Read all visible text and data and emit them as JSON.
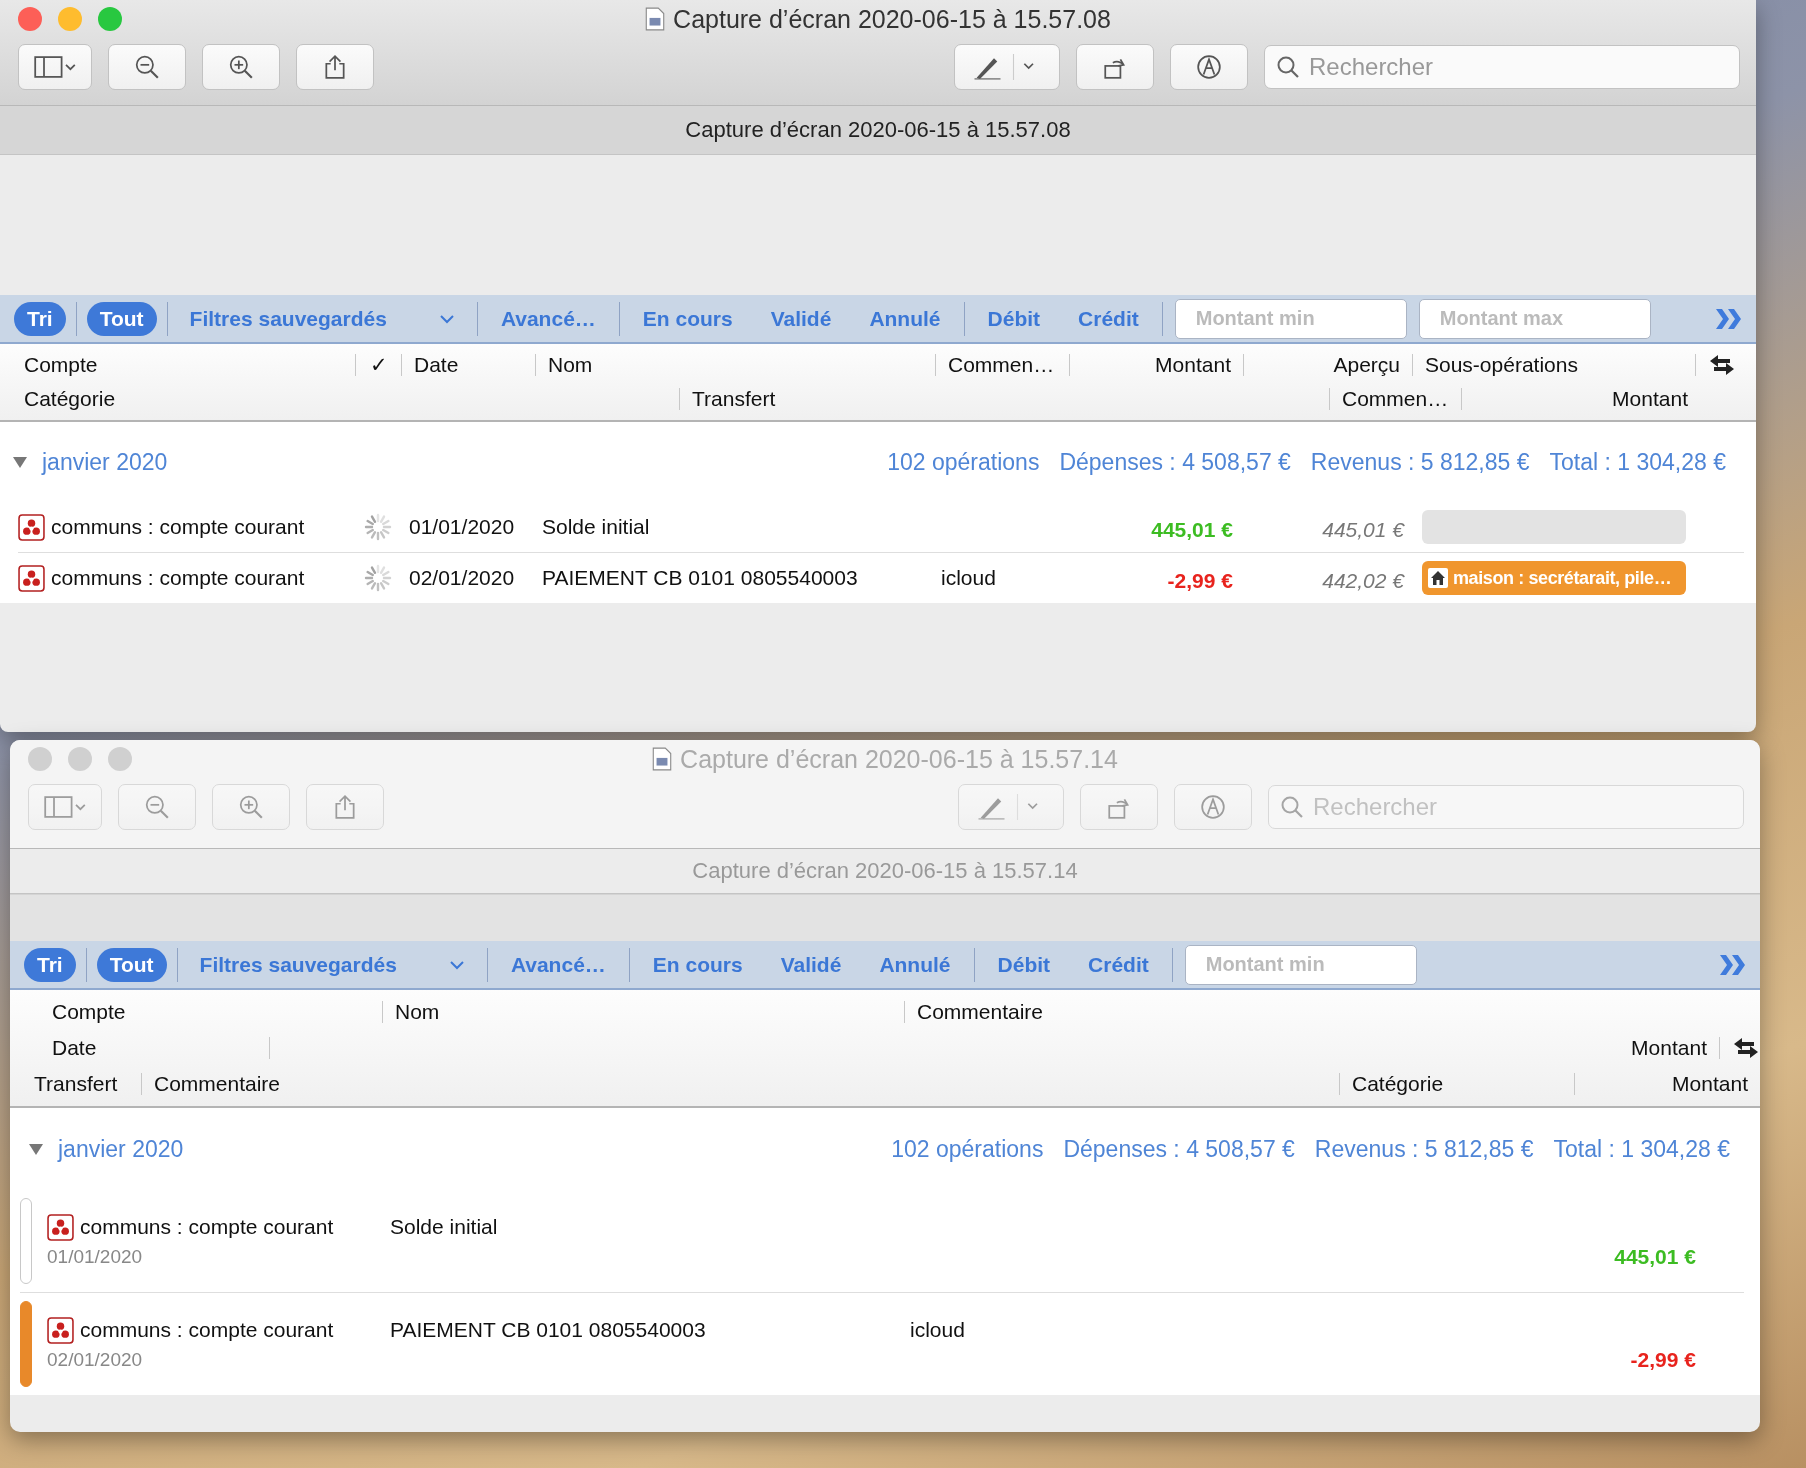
{
  "windows": [
    {
      "kind": "table",
      "active": true,
      "title": "Capture d’écran 2020-06-15 à 15.57.08",
      "search_placeholder": "Rechercher",
      "doc_title": "Capture d’écran 2020-06-15 à 15.57.08",
      "filter_groups": [
        [
          {
            "kind": "toggle",
            "label": "Tri",
            "selected": true
          }
        ],
        [
          {
            "kind": "toggle",
            "label": "Tout",
            "selected": true
          }
        ],
        [
          {
            "kind": "dropdown",
            "label": "Filtres sauvegardés"
          }
        ],
        [
          {
            "kind": "toggle",
            "label": "Avancé…",
            "selected": false
          }
        ],
        [
          {
            "kind": "toggle",
            "label": "En cours",
            "selected": false
          },
          {
            "kind": "toggle",
            "label": "Validé",
            "selected": false
          },
          {
            "kind": "toggle",
            "label": "Annulé",
            "selected": false
          }
        ],
        [
          {
            "kind": "toggle",
            "label": "Débit",
            "selected": false
          },
          {
            "kind": "toggle",
            "label": "Crédit",
            "selected": false
          }
        ]
      ],
      "amount_fields": [
        {
          "placeholder": "Montant min"
        },
        {
          "placeholder": "Montant max"
        }
      ],
      "header_rows": [
        [
          "Compte",
          "✓",
          "Date",
          "Nom",
          "Commen…",
          "Montant",
          "Aperçu",
          "Sous-opérations"
        ],
        [
          "Catégorie",
          "Transfert",
          "Commen…",
          "Montant"
        ]
      ],
      "group": {
        "label": "janvier 2020",
        "expanded": true,
        "stats": [
          "102 opérations",
          "Dépenses : 4 508,57 €",
          "Revenus : 5 812,85 €",
          "Total : 1 304,28 €"
        ]
      },
      "rows": [
        {
          "account": "communs : compte courant",
          "pending": true,
          "date": "01/01/2020",
          "name": "Solde initial",
          "amount": {
            "text": "445,01 €",
            "color": "#3cbc22"
          },
          "balance": "445,01 €"
        },
        {
          "account": "communs : compte courant",
          "pending": true,
          "date": "02/01/2020",
          "name": "PAIEMENT CB 0101 0805540003",
          "comment": "icloud",
          "amount": {
            "text": "-2,99 €",
            "color": "#e8231d"
          },
          "balance": "442,02 €",
          "subop": {
            "label": "maison : secrétarait, pile…",
            "color": "#f0962e"
          }
        }
      ]
    },
    {
      "kind": "stacked",
      "active": false,
      "title": "Capture d’écran 2020-06-15 à 15.57.14",
      "search_placeholder": "Rechercher",
      "doc_title": "Capture d’écran 2020-06-15 à 15.57.14",
      "filter_groups": [
        [
          {
            "kind": "toggle",
            "label": "Tri",
            "selected": true
          }
        ],
        [
          {
            "kind": "toggle",
            "label": "Tout",
            "selected": true
          }
        ],
        [
          {
            "kind": "dropdown",
            "label": "Filtres sauvegardés"
          }
        ],
        [
          {
            "kind": "toggle",
            "label": "Avancé…",
            "selected": false
          }
        ],
        [
          {
            "kind": "toggle",
            "label": "En cours",
            "selected": false
          },
          {
            "kind": "toggle",
            "label": "Validé",
            "selected": false
          },
          {
            "kind": "toggle",
            "label": "Annulé",
            "selected": false
          }
        ],
        [
          {
            "kind": "toggle",
            "label": "Débit",
            "selected": false
          },
          {
            "kind": "toggle",
            "label": "Crédit",
            "selected": false
          }
        ]
      ],
      "amount_fields": [
        {
          "placeholder": "Montant min"
        }
      ],
      "header_rows": [
        [
          "Compte",
          "Nom",
          "Commentaire"
        ],
        [
          "Date",
          "Montant"
        ],
        [
          "Transfert",
          "Commentaire",
          "Catégorie",
          "Montant"
        ]
      ],
      "group": {
        "label": "janvier 2020",
        "expanded": true,
        "stats": [
          "102 opérations",
          "Dépenses : 4 508,57 €",
          "Revenus : 5 812,85 €",
          "Total : 1 304,28 €"
        ]
      },
      "rows": [
        {
          "account": "communs : compte courant",
          "date": "01/01/2020",
          "name": "Solde initial",
          "amount": {
            "text": "445,01 €",
            "color": "#3cbc22"
          }
        },
        {
          "account": "communs : compte courant",
          "date": "02/01/2020",
          "name": "PAIEMENT CB 0101 0805540003",
          "comment": "icloud",
          "amount": {
            "text": "-2,99 €",
            "color": "#e8231d"
          },
          "color": "#e8892a"
        }
      ]
    }
  ]
}
